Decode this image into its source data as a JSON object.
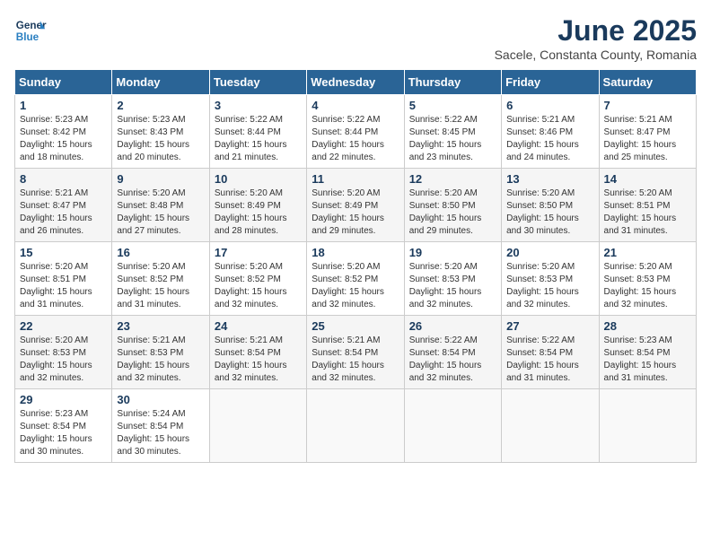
{
  "header": {
    "logo_line1": "General",
    "logo_line2": "Blue",
    "month_title": "June 2025",
    "location": "Sacele, Constanta County, Romania"
  },
  "weekdays": [
    "Sunday",
    "Monday",
    "Tuesday",
    "Wednesday",
    "Thursday",
    "Friday",
    "Saturday"
  ],
  "weeks": [
    [
      {
        "day": "1",
        "info": "Sunrise: 5:23 AM\nSunset: 8:42 PM\nDaylight: 15 hours\nand 18 minutes."
      },
      {
        "day": "2",
        "info": "Sunrise: 5:23 AM\nSunset: 8:43 PM\nDaylight: 15 hours\nand 20 minutes."
      },
      {
        "day": "3",
        "info": "Sunrise: 5:22 AM\nSunset: 8:44 PM\nDaylight: 15 hours\nand 21 minutes."
      },
      {
        "day": "4",
        "info": "Sunrise: 5:22 AM\nSunset: 8:44 PM\nDaylight: 15 hours\nand 22 minutes."
      },
      {
        "day": "5",
        "info": "Sunrise: 5:22 AM\nSunset: 8:45 PM\nDaylight: 15 hours\nand 23 minutes."
      },
      {
        "day": "6",
        "info": "Sunrise: 5:21 AM\nSunset: 8:46 PM\nDaylight: 15 hours\nand 24 minutes."
      },
      {
        "day": "7",
        "info": "Sunrise: 5:21 AM\nSunset: 8:47 PM\nDaylight: 15 hours\nand 25 minutes."
      }
    ],
    [
      {
        "day": "8",
        "info": "Sunrise: 5:21 AM\nSunset: 8:47 PM\nDaylight: 15 hours\nand 26 minutes."
      },
      {
        "day": "9",
        "info": "Sunrise: 5:20 AM\nSunset: 8:48 PM\nDaylight: 15 hours\nand 27 minutes."
      },
      {
        "day": "10",
        "info": "Sunrise: 5:20 AM\nSunset: 8:49 PM\nDaylight: 15 hours\nand 28 minutes."
      },
      {
        "day": "11",
        "info": "Sunrise: 5:20 AM\nSunset: 8:49 PM\nDaylight: 15 hours\nand 29 minutes."
      },
      {
        "day": "12",
        "info": "Sunrise: 5:20 AM\nSunset: 8:50 PM\nDaylight: 15 hours\nand 29 minutes."
      },
      {
        "day": "13",
        "info": "Sunrise: 5:20 AM\nSunset: 8:50 PM\nDaylight: 15 hours\nand 30 minutes."
      },
      {
        "day": "14",
        "info": "Sunrise: 5:20 AM\nSunset: 8:51 PM\nDaylight: 15 hours\nand 31 minutes."
      }
    ],
    [
      {
        "day": "15",
        "info": "Sunrise: 5:20 AM\nSunset: 8:51 PM\nDaylight: 15 hours\nand 31 minutes."
      },
      {
        "day": "16",
        "info": "Sunrise: 5:20 AM\nSunset: 8:52 PM\nDaylight: 15 hours\nand 31 minutes."
      },
      {
        "day": "17",
        "info": "Sunrise: 5:20 AM\nSunset: 8:52 PM\nDaylight: 15 hours\nand 32 minutes."
      },
      {
        "day": "18",
        "info": "Sunrise: 5:20 AM\nSunset: 8:52 PM\nDaylight: 15 hours\nand 32 minutes."
      },
      {
        "day": "19",
        "info": "Sunrise: 5:20 AM\nSunset: 8:53 PM\nDaylight: 15 hours\nand 32 minutes."
      },
      {
        "day": "20",
        "info": "Sunrise: 5:20 AM\nSunset: 8:53 PM\nDaylight: 15 hours\nand 32 minutes."
      },
      {
        "day": "21",
        "info": "Sunrise: 5:20 AM\nSunset: 8:53 PM\nDaylight: 15 hours\nand 32 minutes."
      }
    ],
    [
      {
        "day": "22",
        "info": "Sunrise: 5:20 AM\nSunset: 8:53 PM\nDaylight: 15 hours\nand 32 minutes."
      },
      {
        "day": "23",
        "info": "Sunrise: 5:21 AM\nSunset: 8:53 PM\nDaylight: 15 hours\nand 32 minutes."
      },
      {
        "day": "24",
        "info": "Sunrise: 5:21 AM\nSunset: 8:54 PM\nDaylight: 15 hours\nand 32 minutes."
      },
      {
        "day": "25",
        "info": "Sunrise: 5:21 AM\nSunset: 8:54 PM\nDaylight: 15 hours\nand 32 minutes."
      },
      {
        "day": "26",
        "info": "Sunrise: 5:22 AM\nSunset: 8:54 PM\nDaylight: 15 hours\nand 32 minutes."
      },
      {
        "day": "27",
        "info": "Sunrise: 5:22 AM\nSunset: 8:54 PM\nDaylight: 15 hours\nand 31 minutes."
      },
      {
        "day": "28",
        "info": "Sunrise: 5:23 AM\nSunset: 8:54 PM\nDaylight: 15 hours\nand 31 minutes."
      }
    ],
    [
      {
        "day": "29",
        "info": "Sunrise: 5:23 AM\nSunset: 8:54 PM\nDaylight: 15 hours\nand 30 minutes."
      },
      {
        "day": "30",
        "info": "Sunrise: 5:24 AM\nSunset: 8:54 PM\nDaylight: 15 hours\nand 30 minutes."
      },
      null,
      null,
      null,
      null,
      null
    ]
  ]
}
